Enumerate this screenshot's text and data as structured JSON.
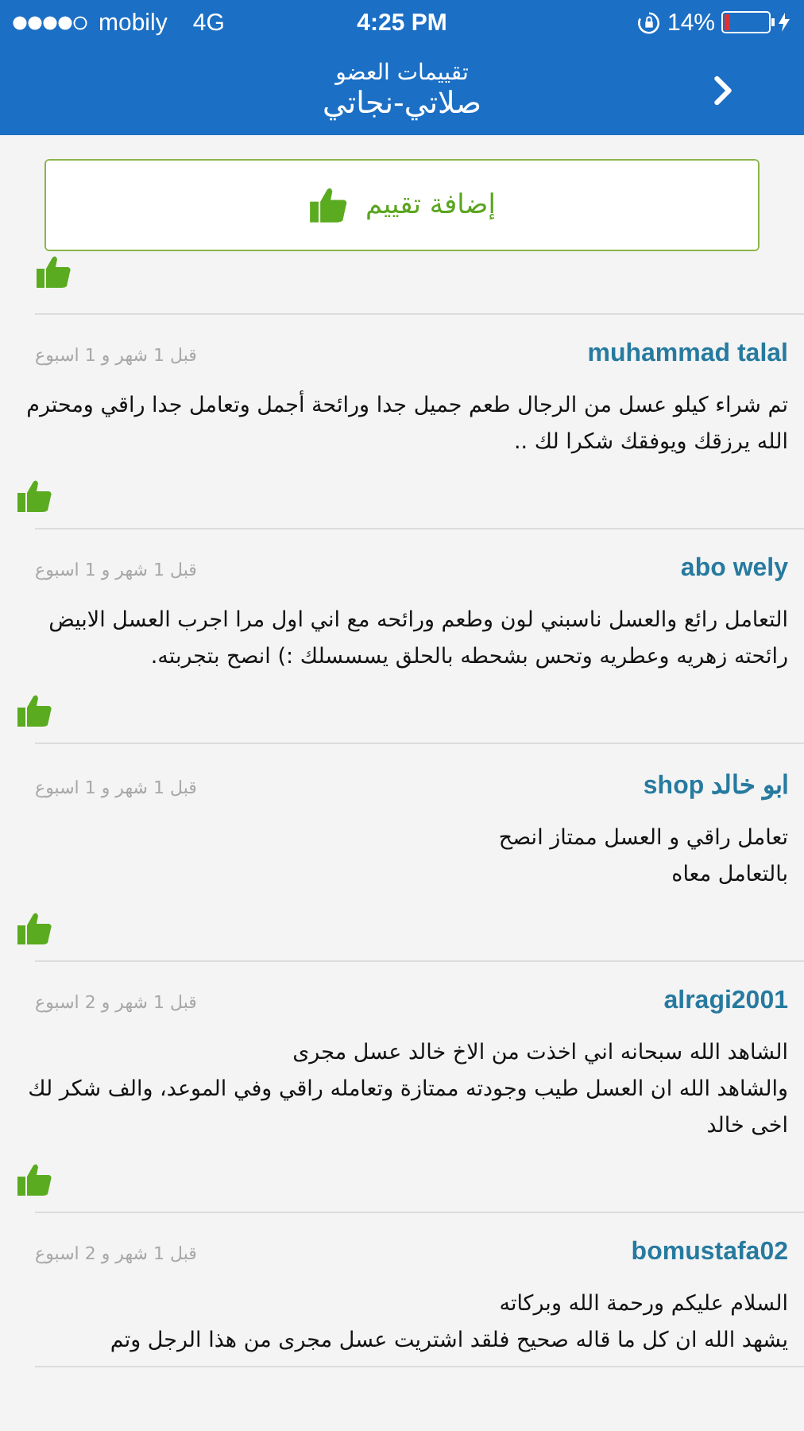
{
  "status_bar": {
    "carrier": "mobily",
    "network": "4G",
    "time": "4:25 PM",
    "battery": "14%"
  },
  "header": {
    "subtitle": "تقييمات العضو",
    "title": "صلاتي-نجاتي"
  },
  "add_rating_button": {
    "label": "إضافة تقييم"
  },
  "reviews": [
    {
      "kind": "partial"
    },
    {
      "kind": "full",
      "author": "muhammad talal",
      "date": "قبل 1 شهر و 1 اسبوع",
      "text": "تم شراء كيلو عسل من الرجال طعم جميل جدا ورائحة أجمل وتعامل جدا راقي ومحترم الله يرزقك ويوفقك شكرا لك .."
    },
    {
      "kind": "full",
      "author": "abo wely",
      "date": "قبل 1 شهر و 1 اسبوع",
      "text": "التعامل رائع والعسل ناسبني لون وطعم ورائحه مع اني اول مرا اجرب العسل الابيض رائحته زهريه وعطريه وتحس بشحطه بالحلق يسسسلك :) انصح بتجربته."
    },
    {
      "kind": "full",
      "author": "ابو خالد shop",
      "date": "قبل 1 شهر و 1 اسبوع",
      "text": "تعامل راقي و العسل ممتاز انصح\nبالتعامل معاه"
    },
    {
      "kind": "full",
      "author": "alragi2001",
      "date": "قبل 1 شهر و 2 اسبوع",
      "text": "الشاهد الله سبحانه اني اخذت من الاخ خالد عسل مجرى\nوالشاهد الله ان العسل طيب وجودته ممتازة وتعامله راقي وفي الموعد، والف شكر لك اخى خالد"
    },
    {
      "kind": "cut",
      "author": "bomustafa02",
      "date": "قبل 1 شهر و 2 اسبوع",
      "text": "السلام عليكم ورحمة الله وبركاته\nيشهد الله ان كل ما قاله صحيح فلقد اشتريت عسل مجرى من هذا الرجل وتم"
    }
  ]
}
